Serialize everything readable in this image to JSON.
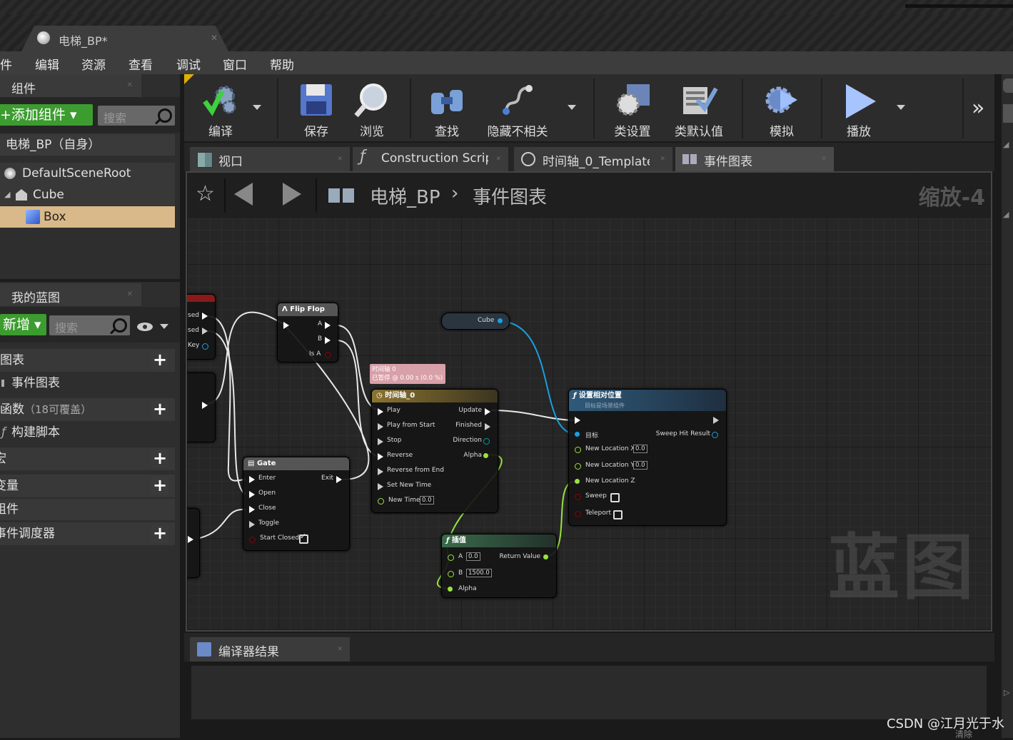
{
  "document_tab": {
    "title": "电梯_BP*"
  },
  "menu": [
    "件",
    "编辑",
    "资源",
    "查看",
    "调试",
    "窗口",
    "帮助"
  ],
  "components_panel": {
    "tab_label": "组件",
    "add_button": "+添加组件",
    "search_placeholder": "搜索",
    "self_label": "电梯_BP（自身）",
    "tree": [
      {
        "label": "DefaultSceneRoot",
        "icon": "scene-root-icon"
      },
      {
        "label": "Cube",
        "icon": "static-mesh-icon"
      },
      {
        "label": "Box",
        "icon": "box-collision-icon",
        "selected": true
      }
    ]
  },
  "my_blueprint_panel": {
    "tab_label": "我的蓝图",
    "add_button": "新增",
    "search_placeholder": "搜索",
    "sections": [
      {
        "label": "图表",
        "has_add": true
      },
      {
        "label": "事件图表",
        "has_add": false
      },
      {
        "label": "函数",
        "suffix": "（18可覆盖）",
        "has_add": true
      },
      {
        "label": "构建脚本",
        "has_add": false
      },
      {
        "label": "宏",
        "has_add": true
      },
      {
        "label": "变量",
        "has_add": true
      },
      {
        "label": "组件",
        "has_add": false
      },
      {
        "label": "事件调度器",
        "has_add": true
      }
    ]
  },
  "toolbar": {
    "compile": "编译",
    "save": "保存",
    "browse": "浏览",
    "find": "查找",
    "hide_unrelated": "隐藏不相关",
    "class_settings": "类设置",
    "class_defaults": "类默认值",
    "simulate": "模拟",
    "play": "播放"
  },
  "graph_tabs": [
    {
      "label": "视口"
    },
    {
      "label": "Construction Script"
    },
    {
      "label": "时间轴_0_Template"
    },
    {
      "label": "事件图表",
      "active": true
    }
  ],
  "breadcrumb": {
    "root": "电梯_BP",
    "current": "事件图表"
  },
  "zoom_label": "缩放-4",
  "watermark": "蓝图",
  "nodes": {
    "partial_event": {
      "pins": [
        "sed",
        "sed",
        "Key"
      ]
    },
    "flip_flop": {
      "title": "Flip Flop",
      "pins": [
        "A",
        "B",
        "Is A"
      ]
    },
    "cube_ref": {
      "label": "Cube"
    },
    "timeline_tooltip": {
      "line1": "时间轴 0",
      "line2": "已暂停 @ 0.00 s (0.0 %)"
    },
    "timeline": {
      "title": "时间轴_0",
      "inputs": [
        "Play",
        "Play from Start",
        "Stop",
        "Reverse",
        "Reverse from End",
        "Set New Time",
        "New Time"
      ],
      "new_time_value": "0.0",
      "outputs": [
        "Update",
        "Finished",
        "Direction",
        "Alpha"
      ]
    },
    "gate": {
      "title": "Gate",
      "inputs": [
        "Enter",
        "Open",
        "Close",
        "Toggle",
        "Start Closed"
      ],
      "output": "Exit"
    },
    "set_location": {
      "title": "设置相对位置",
      "subtitle": "目标是场景组件",
      "target": "目标",
      "sweep_hit": "Sweep Hit Result",
      "new_x": "New Location X",
      "new_y": "New Location Y",
      "new_z": "New Location Z",
      "x_val": "0.0",
      "y_val": "0.0",
      "sweep": "Sweep",
      "teleport": "Teleport"
    },
    "lerp": {
      "title": "插值",
      "a": "A",
      "a_val": "0.0",
      "b": "B",
      "b_val": "1500.0",
      "alpha": "Alpha",
      "ret": "Return Value"
    }
  },
  "compiler": {
    "tab_label": "编译器结果",
    "clear_label": "清除"
  },
  "footer": "CSDN @江月光于水",
  "colors": {
    "exec": "#ffffff",
    "float": "#9be33c",
    "object": "#1a9fe0",
    "bool": "#8b0000",
    "accent_green": "#3c9c2f"
  }
}
